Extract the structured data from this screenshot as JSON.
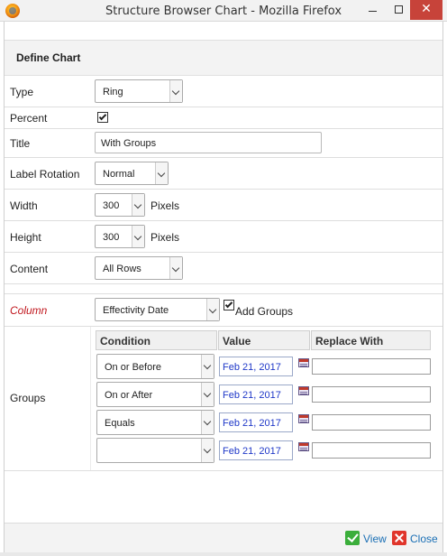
{
  "window": {
    "title": "Structure Browser Chart - Mozilla Firefox",
    "minimize_glyph": "",
    "maximize_glyph": "",
    "close_glyph": "✕"
  },
  "section": {
    "title": "Define Chart"
  },
  "fields": {
    "type": {
      "label": "Type",
      "value": "Ring"
    },
    "percent": {
      "label": "Percent",
      "checked": true
    },
    "title": {
      "label": "Title",
      "value": "With Groups"
    },
    "label_rotation": {
      "label": "Label Rotation",
      "value": "Normal"
    },
    "width": {
      "label": "Width",
      "value": "300",
      "unit": "Pixels"
    },
    "height": {
      "label": "Height",
      "value": "300",
      "unit": "Pixels"
    },
    "content": {
      "label": "Content",
      "value": "All Rows"
    },
    "column": {
      "label": "Column",
      "value": "Effectivity Date",
      "add_groups_label": "Add Groups",
      "add_groups_checked": true
    }
  },
  "groups": {
    "label": "Groups",
    "headers": [
      "Condition",
      "Value",
      "Replace With"
    ],
    "rows": [
      {
        "condition": "On or Before",
        "value": "Feb 21, 2017",
        "replace": ""
      },
      {
        "condition": "On or After",
        "value": "Feb 21, 2017",
        "replace": ""
      },
      {
        "condition": "Equals",
        "value": "Feb 21, 2017",
        "replace": ""
      },
      {
        "condition": "",
        "value": "Feb 21, 2017",
        "replace": ""
      }
    ]
  },
  "footer": {
    "view_label": "View",
    "close_label": "Close"
  }
}
